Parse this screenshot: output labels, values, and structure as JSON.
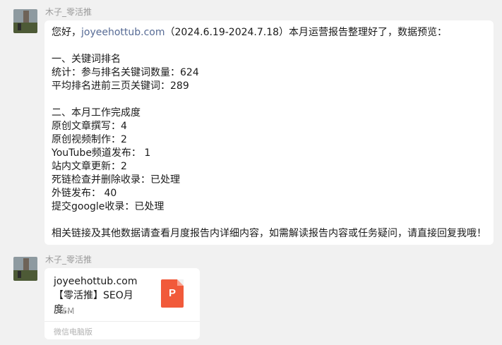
{
  "messages": [
    {
      "sender": "木子_零活推",
      "greeting_prefix": "您好，",
      "link_text": "joyeehottub.com",
      "greeting_suffix": "（2024.6.19-2024.7.18）本月运营报告整理好了，数据预览：",
      "lines": [
        "",
        "一、关键词排名",
        "统计：参与排名关键词数量：624",
        "平均排名进前三页关键词：289",
        "",
        "二、本月工作完成度",
        "原创文章撰写：4",
        "原创视频制作：2",
        "YouTube频道发布： 1",
        "站内文章更新：2",
        "死链检查并删除收录：已处理",
        "外链发布： 40",
        "提交google收录：已处理",
        "",
        "相关链接及其他数据请查看月度报告内详细内容，如需解读报告内容或任务疑问，请直接回复我哦！"
      ]
    },
    {
      "sender": "木子_零活推",
      "file": {
        "title": "joyeehottub.com 【零活推】SEO月度...",
        "size": "3.6M",
        "source": "微信电脑版",
        "icon": "powerpoint-file-icon",
        "icon_letter": "P",
        "icon_color": "#f15a3a"
      }
    }
  ]
}
